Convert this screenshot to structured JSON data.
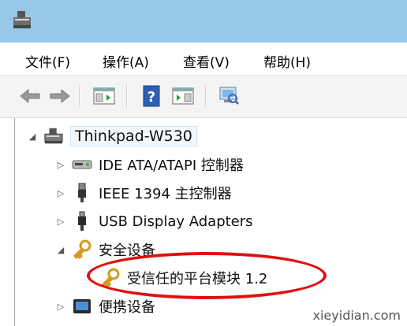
{
  "menu": {
    "file": "文件(F)",
    "action": "操作(A)",
    "view": "查看(V)",
    "help": "帮助(H)"
  },
  "tree": {
    "root": "Thinkpad-W530",
    "items": [
      {
        "label": "IDE ATA/ATAPI 控制器",
        "icon": "ide-controller-icon",
        "expanded": false
      },
      {
        "label": "IEEE 1394 主控制器",
        "icon": "firewire-icon",
        "expanded": false
      },
      {
        "label": "USB Display Adapters",
        "icon": "usb-plug-icon",
        "expanded": false
      },
      {
        "label": "安全设备",
        "icon": "security-key-icon",
        "expanded": true,
        "children": [
          {
            "label": "受信任的平台模块 1.2",
            "icon": "security-key-icon"
          }
        ]
      },
      {
        "label": "便携设备",
        "icon": "portable-device-icon",
        "expanded": false
      }
    ]
  },
  "watermark": "xieyidian.com",
  "colors": {
    "titlebar": "#97c8ea",
    "highlight": "#e01010"
  }
}
